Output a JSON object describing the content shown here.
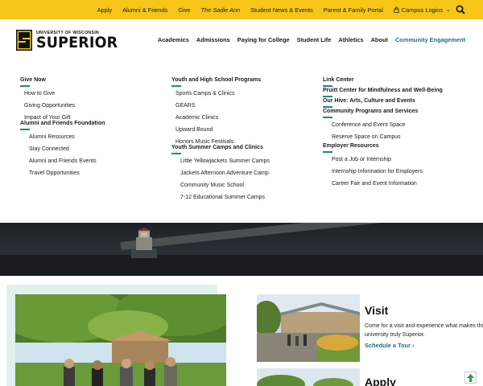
{
  "utility_bar": {
    "links": [
      "Apply",
      "Alumni & Friends",
      "Give",
      "The Sadie Ann",
      "Student News & Events",
      "Parent & Family Portal"
    ],
    "campus_logins": "Campus Logins",
    "accent": "#f5c518"
  },
  "logo": {
    "university": "UNIVERSITY OF WISCONSIN",
    "name": "SUPERIOR"
  },
  "main_nav": {
    "items": [
      "Academics",
      "Admissions",
      "Paying for College",
      "Student Life",
      "Athletics",
      "About",
      "Community Engagement"
    ],
    "active_color": "#1b6f8a"
  },
  "mega_menu": {
    "col1": {
      "give_now": "Give Now",
      "give_items": [
        "How to Give",
        "Giving Opportunities",
        "Impact of Your Gift"
      ],
      "alumni": "Alumni and Friends Foundation",
      "alumni_items": [
        "Alumni Resources",
        "Stay Connected",
        "Alumni and Friends Events",
        "Travel Opportunities"
      ]
    },
    "col2": {
      "youth": "Youth and High School Programs",
      "youth_items": [
        "Sports Camps & Clinics",
        "GEARS",
        "Academic Clinics",
        "Upward Bound",
        "Honors Music Festivals"
      ],
      "summer": "Youth Summer Camps and Clinics",
      "summer_items": [
        "Little Yellowjackets Summer Camps",
        "Jackets Afternoon Adventure Camp",
        "Community Music School",
        "7-12 Educational Summer Camps"
      ]
    },
    "col3": {
      "link_center": "Link Center",
      "pruitt": "Pruitt Center for Mindfulness and Well-Being",
      "hive": "Our Hive: Arts, Culture and Events",
      "community": "Community Programs and Services",
      "community_items": [
        "Conference and Event Space",
        "Reserve Space on Campus"
      ],
      "employer": "Employer Resources",
      "employer_items": [
        "Post a Job or Internship",
        "Internship Information for Employers",
        "Career Fair and Event Information"
      ]
    },
    "accent": "#1e8a7e"
  },
  "visit": {
    "title": "Visit",
    "text": "Come for a visit and experience what makes this university truly Superior.",
    "link": "Schedule a Tour"
  },
  "apply": {
    "title": "Apply"
  }
}
